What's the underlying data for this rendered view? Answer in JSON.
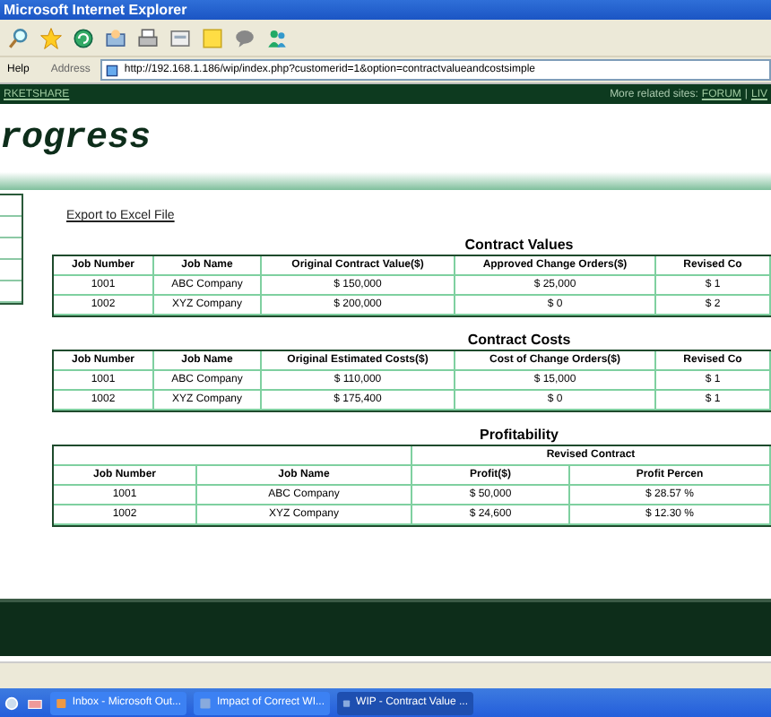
{
  "window": {
    "title": "Microsoft Internet Explorer"
  },
  "menu": [
    "Help"
  ],
  "address": {
    "label": "Address",
    "value": "http://192.168.1.186/wip/index.php?customerid=1&option=contractvalueandcostsimple"
  },
  "nav_bar": {
    "left_link": "RKETSHARE",
    "right_text": "More related sites:",
    "separator": "|",
    "right_links": [
      "FORUM",
      "LIV"
    ]
  },
  "page_title": "rogress",
  "export_link": "Export to Excel File",
  "tables": [
    {
      "title": "Contract Values",
      "columns": [
        "Job Number",
        "Job Name",
        "Original Contract Value($)",
        "Approved Change Orders($)",
        "Revised Co"
      ],
      "rows": [
        [
          "1001",
          "ABC Company",
          "$ 150,000",
          "$ 25,000",
          "$ 1"
        ],
        [
          "1002",
          "XYZ Company",
          "$ 200,000",
          "$ 0",
          "$ 2"
        ]
      ]
    },
    {
      "title": "Contract Costs",
      "columns": [
        "Job Number",
        "Job Name",
        "Original Estimated Costs($)",
        "Cost of Change Orders($)",
        "Revised Co"
      ],
      "rows": [
        [
          "1001",
          "ABC Company",
          "$ 110,000",
          "$ 15,000",
          "$ 1"
        ],
        [
          "1002",
          "XYZ Company",
          "$ 175,400",
          "$ 0",
          "$ 1"
        ]
      ]
    },
    {
      "title": "Profitability",
      "group_header": "Revised Contract",
      "columns": [
        "Job Number",
        "Job Name",
        "Profit($)",
        "Profit Percen"
      ],
      "rows": [
        [
          "1001",
          "ABC Company",
          "$ 50,000",
          "$ 28.57 %"
        ],
        [
          "1002",
          "XYZ Company",
          "$ 24,600",
          "$ 12.30 %"
        ]
      ]
    }
  ],
  "taskbar": [
    {
      "label": "Inbox - Microsoft Out...",
      "selected": false
    },
    {
      "label": "Impact of Correct WI...",
      "selected": false
    },
    {
      "label": "WIP - Contract Value ...",
      "selected": true
    }
  ]
}
